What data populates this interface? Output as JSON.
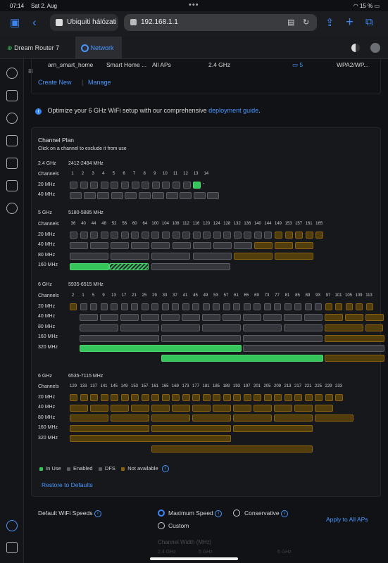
{
  "status_bar": {
    "time": "07:14",
    "date": "Sat 2. Aug",
    "dots": "•••",
    "battery": "15 %"
  },
  "browser": {
    "tab_title": "Ubiquiti hálózati",
    "url": "192.168.1.1"
  },
  "app_tabs": [
    {
      "label": "Dream Router 7"
    },
    {
      "label": "Network"
    }
  ],
  "wifi_row": {
    "name": "arn_smart_home",
    "network": "Smart Home ...",
    "aps": "All APs",
    "band": "2.4 GHz",
    "count": "5",
    "security": "WPA2/WP..."
  },
  "actions": {
    "create_new": "Create New",
    "manage": "Manage"
  },
  "banner": {
    "text": "Optimize your 6 GHz WiFi setup with our comprehensive ",
    "link": "deployment guide",
    "suffix": "."
  },
  "channel_plan": {
    "title": "Channel Plan",
    "subtitle": "Click on a channel to exclude it from use",
    "row_labels": {
      "channels": "Channels",
      "w20": "20 MHz",
      "w40": "40 MHz",
      "w80": "80 MHz",
      "w160": "160 MHz",
      "w320": "320 MHz"
    },
    "dash": "-",
    "b24": {
      "band": "2.4 GHz",
      "range": "2412-2484 MHz",
      "channels": [
        "1",
        "2",
        "3",
        "4",
        "5",
        "6",
        "7",
        "8",
        "9",
        "10",
        "11",
        "12",
        "13",
        "14"
      ]
    },
    "b5": {
      "band": "5 GHz",
      "range": "5180-5885 MHz",
      "channels": [
        "36",
        "40",
        "44",
        "48",
        "52",
        "56",
        "60",
        "64",
        "100",
        "104",
        "108",
        "112",
        "116",
        "120",
        "124",
        "128",
        "132",
        "136",
        "140",
        "144",
        "149",
        "153",
        "157",
        "161",
        "165"
      ]
    },
    "b6a": {
      "band": "6 GHz",
      "range": "5935-6515 MHz",
      "channels": [
        "2",
        "1",
        "5",
        "9",
        "13",
        "17",
        "21",
        "25",
        "29",
        "33",
        "37",
        "41",
        "45",
        "49",
        "53",
        "57",
        "61",
        "65",
        "69",
        "73",
        "77",
        "81",
        "85",
        "89",
        "93",
        "97",
        "101",
        "105",
        "109",
        "113"
      ]
    },
    "b6b": {
      "band": "6 GHz",
      "range": "6535-7115 MHz",
      "channels": [
        "129",
        "133",
        "137",
        "141",
        "145",
        "149",
        "153",
        "157",
        "161",
        "165",
        "169",
        "173",
        "177",
        "181",
        "185",
        "189",
        "193",
        "197",
        "201",
        "205",
        "209",
        "213",
        "217",
        "221",
        "225",
        "229",
        "233"
      ]
    }
  },
  "legend": {
    "in_use": "In Use",
    "enabled": "Enabled",
    "dfs": "DFS",
    "not_available": "Not available"
  },
  "restore": "Restore to Defaults",
  "speeds": {
    "label": "Default WiFi Speeds",
    "max": "Maximum Speed",
    "conservative": "Conservative",
    "custom": "Custom",
    "apply": "Apply to All APs",
    "channel_width": "Channel Width (MHz)",
    "cw_24": "2.4 GHz",
    "cw_5": "5 GHz",
    "cw_6": "6 GHz"
  },
  "colors": {
    "accent": "#4797ff",
    "in_use": "#36c55a",
    "not_available": "#8a6311"
  }
}
